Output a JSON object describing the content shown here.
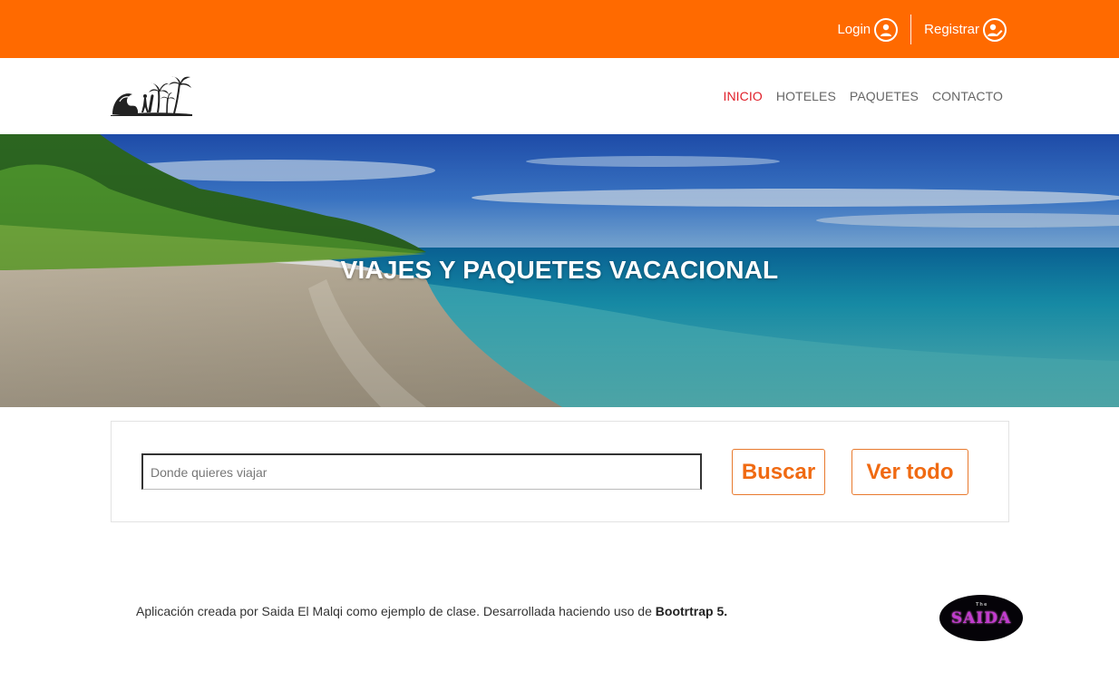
{
  "topbar": {
    "color": "#ff6a00",
    "login_label": "Login",
    "login_icon": "user-icon",
    "register_label": "Registrar",
    "register_icon": "user-edit-icon"
  },
  "nav": {
    "logo_icon": "beach-surfer-logo",
    "items": [
      {
        "label": "INICIO",
        "active": true
      },
      {
        "label": "HOTELES",
        "active": false
      },
      {
        "label": "PAQUETES",
        "active": false
      },
      {
        "label": "CONTACTO",
        "active": false
      }
    ],
    "active_color": "#e0202a"
  },
  "hero": {
    "title": "VIAJES Y PAQUETES VACACIONAL"
  },
  "search": {
    "placeholder": "Donde quieres viajar",
    "value": "",
    "search_button": "Buscar",
    "view_all_button": "Ver todo",
    "accent_color": "#f06a12"
  },
  "footer": {
    "text_prefix": "Aplicación creada por Saida El Malqi como ejemplo de clase. Desarrollada haciendo uso de ",
    "text_bold": "Bootrtrap 5.",
    "badge_text": "SAIDA",
    "badge_small_text": "The"
  }
}
